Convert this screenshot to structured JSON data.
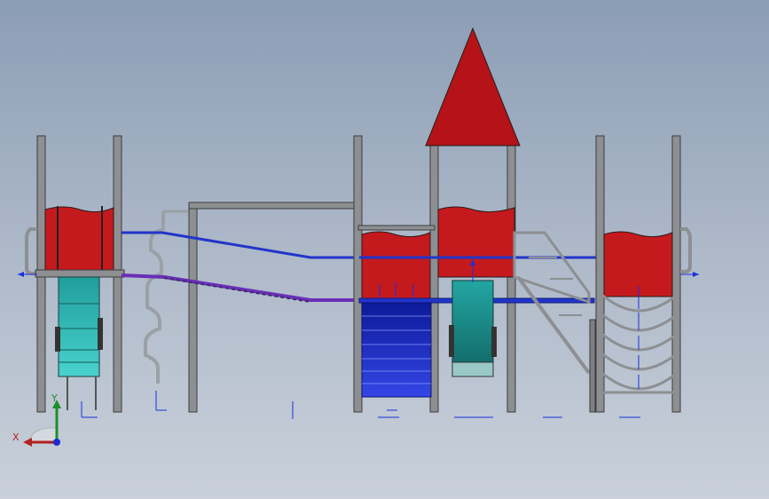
{
  "viewport": {
    "background_top": "#8b9db5",
    "background_bottom": "#c9d0da"
  },
  "colors": {
    "post": "#8d8f92",
    "post_edge": "#3c3c3c",
    "roof": "#b51317",
    "panel": "#c41a1d",
    "slide_teal": "#31b6b4",
    "ladder_blue": "#1f31c7",
    "rail_blue": "#2235c9",
    "rail_purple": "#6a2fb8",
    "dim_blue": "#1b2fe0"
  },
  "triad": {
    "x_label": "X",
    "y_label": "Y",
    "x_color": "#b3211f",
    "y_color": "#1b8f2b",
    "z_color": "#1d2bd1"
  }
}
